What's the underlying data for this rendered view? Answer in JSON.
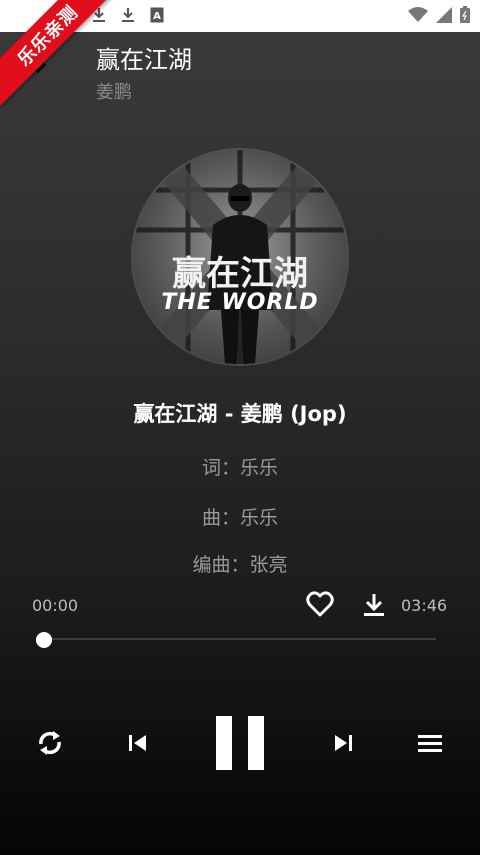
{
  "status_bar": {
    "left_icons": [
      "download-icon",
      "download-icon",
      "a-icon"
    ],
    "right_icons": [
      "wifi-icon",
      "signal-icon",
      "battery-icon"
    ]
  },
  "badge": {
    "text": "乐乐亲测",
    "color": "#e00f1b"
  },
  "header": {
    "title": "赢在江湖",
    "artist": "姜鹏"
  },
  "cover": {
    "title_text": "赢在江湖",
    "subtitle_text": "THE WORLD"
  },
  "lyrics": {
    "current": "赢在江湖 - 姜鹏 (Jop)",
    "lines": [
      "词：乐乐",
      "曲：乐乐",
      "编曲：张亮"
    ]
  },
  "player": {
    "current_time": "00:00",
    "total_time": "03:46",
    "progress": 0.0,
    "favorite_icon": "heart-outline-icon",
    "download_icon": "download-icon"
  },
  "controls": [
    "repeat-icon",
    "previous-icon",
    "pause-icon",
    "next-icon",
    "playlist-icon"
  ]
}
